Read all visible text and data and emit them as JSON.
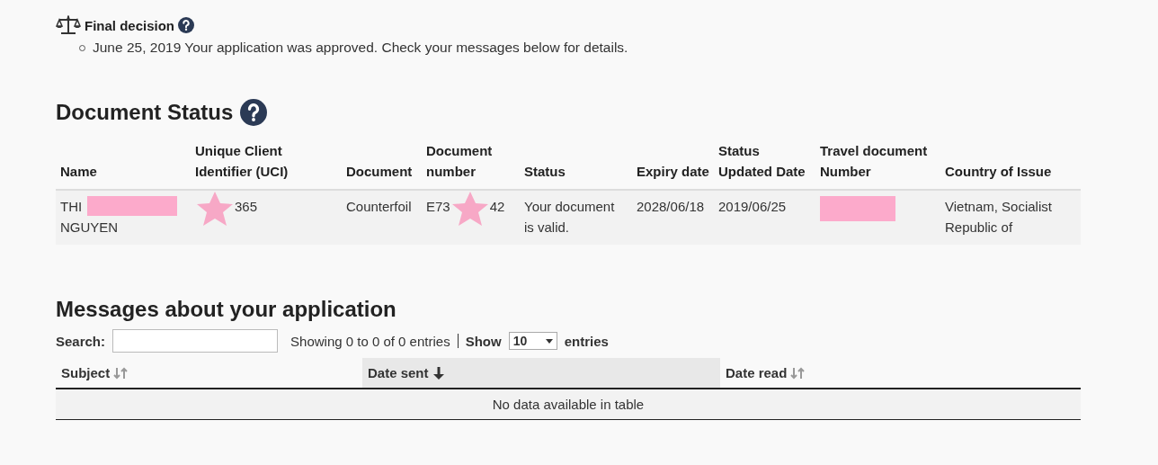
{
  "decision": {
    "title": "Final decision",
    "items": [
      "June 25, 2019 Your application was approved. Check your messages below for details."
    ]
  },
  "document_status": {
    "title": "Document Status",
    "columns": [
      "Name",
      "Unique Client Identifier (UCI)",
      "Document",
      "Document number",
      "Status",
      "Expiry date",
      "Status Updated Date",
      "Travel document Number",
      "Country of Issue"
    ],
    "rows": [
      {
        "cells": [
          [
            "THI",
            {
              "kind": "block"
            },
            "NGUYEN"
          ],
          [
            {
              "kind": "star"
            },
            "365"
          ],
          [
            "Counterfoil"
          ],
          [
            "E73",
            {
              "kind": "star"
            },
            "42"
          ],
          [
            "Your document is valid."
          ],
          [
            "2028/06/18"
          ],
          [
            "2019/06/25"
          ],
          [
            {
              "kind": "block"
            }
          ],
          [
            "Vietnam, Socialist Republic of"
          ]
        ]
      }
    ]
  },
  "messages": {
    "title": "Messages about your application",
    "search_label": "Search:",
    "info": "Showing 0 to 0 of 0 entries",
    "show_label": "Show",
    "page_size": "10",
    "entries_label": "entries",
    "columns": [
      {
        "label": "Subject",
        "kind": "sortable",
        "selected": false
      },
      {
        "label": "Date sent",
        "kind": "descending",
        "selected": true
      },
      {
        "label": "Date read",
        "kind": "sortable",
        "selected": false
      }
    ],
    "empty": "No data available in table"
  }
}
